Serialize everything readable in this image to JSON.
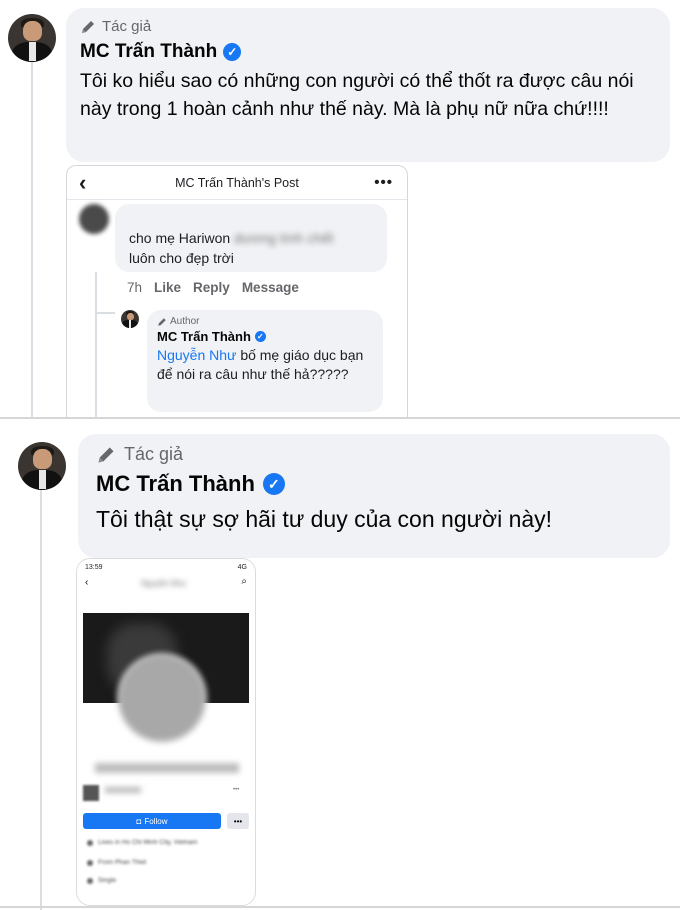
{
  "section1": {
    "author_badge": "Tác giả",
    "name": "MC Trấn Thành",
    "body": "Tôi ko hiểu sao có những con người có thể thốt ra được câu nói này trong 1 hoàn cảnh như thế này. Mà là phụ nữ nữa chứ!!!!",
    "screenshot": {
      "header_title": "MC Trấn Thành's Post",
      "back_glyph": "‹",
      "more_glyph": "•••",
      "comment": {
        "text_visible": "cho mẹ Hariwon",
        "text_blurred": "dương tính chết",
        "text_line2": "luôn cho đẹp trời",
        "time": "7h",
        "like": "Like",
        "reply": "Reply",
        "message": "Message"
      },
      "reply": {
        "author_badge": "Author",
        "name": "MC Trấn Thành",
        "mention": "Nguyễn Như",
        "text": "bố mẹ giáo dục bạn để nói ra câu như thế hả?????"
      }
    }
  },
  "section2": {
    "author_badge": "Tác giả",
    "name": "MC Trấn Thành",
    "body": "Tôi thật sự sợ hãi tư duy của con người này!",
    "phone": {
      "time": "13:59",
      "signal": "4G",
      "nav_title_blurred": "Nguyễn Như",
      "follow_label": "Follow",
      "more_label": "•••",
      "info_lines": [
        "Lives in Ho Chi Minh City, Vietnam",
        "From Phan Thiet",
        "Single"
      ]
    }
  },
  "icons": {
    "pencil": "pencil-icon",
    "verified": "verified-badge-icon"
  },
  "colors": {
    "accent": "#1877f2",
    "bubble": "#f0f2f5",
    "muted": "#65676b"
  }
}
